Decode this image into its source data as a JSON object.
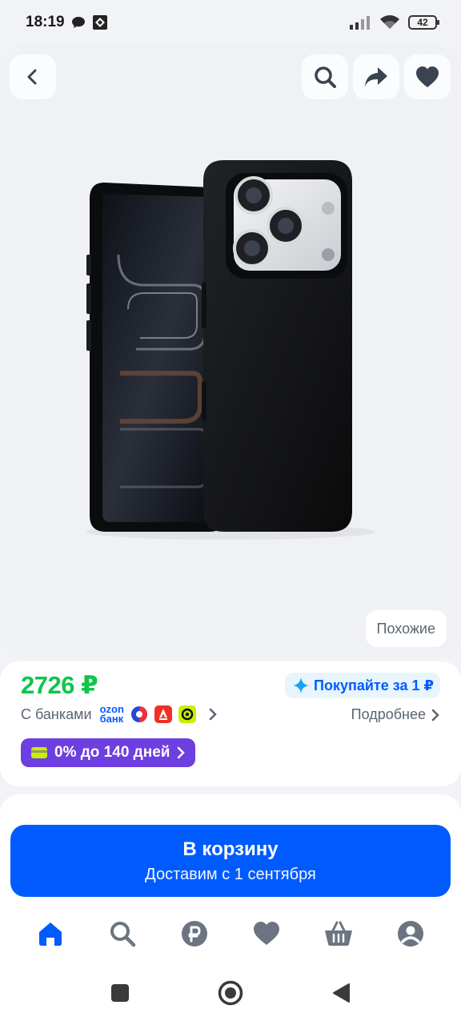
{
  "status_bar": {
    "time": "18:19",
    "battery": "42"
  },
  "header": {
    "back": "back-icon",
    "search": "search-icon",
    "share": "share-icon",
    "favorite": "heart-icon"
  },
  "hero": {
    "similar_label": "Похожие"
  },
  "price_block": {
    "price": "2726 ₽",
    "promo_label": "Покупайте за 1 ₽",
    "banks_label": "С банками",
    "ozon_bank_line1": "ozon",
    "ozon_bank_line2": "банк",
    "more_label": "Подробнее",
    "installment_label": "0% до 140 дней"
  },
  "cart_button": {
    "title": "В корзину",
    "subtitle": "Доставим с 1 сентября"
  },
  "tabs": [
    {
      "name": "home",
      "icon": "home-icon",
      "active": true
    },
    {
      "name": "search",
      "icon": "search-icon"
    },
    {
      "name": "payments",
      "icon": "ruble-icon"
    },
    {
      "name": "favorites",
      "icon": "heart-icon"
    },
    {
      "name": "cart",
      "icon": "basket-icon"
    },
    {
      "name": "profile",
      "icon": "profile-icon"
    }
  ],
  "colors": {
    "accent": "#005bff",
    "price": "#10c44c",
    "installment": "#6e3fe0"
  }
}
